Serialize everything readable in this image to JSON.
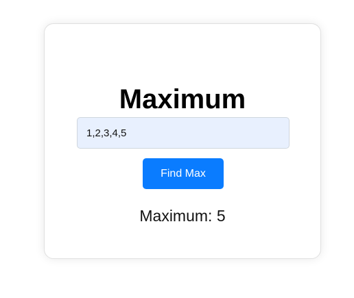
{
  "card": {
    "title": "Maximum",
    "input": {
      "value": "1,2,3,4,5",
      "placeholder": ""
    },
    "button_label": "Find Max",
    "result_text": "Maximum: 5"
  },
  "colors": {
    "button_background": "#0a7cff",
    "button_text": "#ffffff",
    "input_background": "#e8f0fe",
    "title_text": "#000000",
    "card_border": "#e0e0e0"
  }
}
